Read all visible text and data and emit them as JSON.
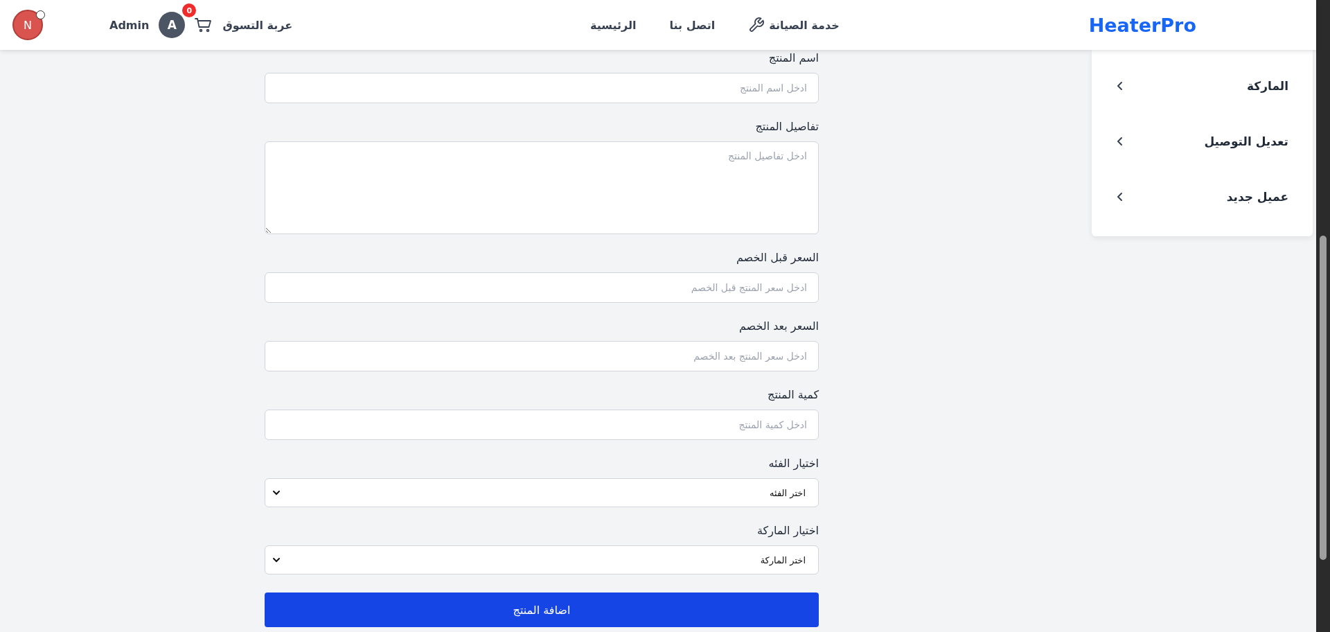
{
  "header": {
    "logo": "HeaterPro",
    "nav": [
      {
        "label": "خدمة الصيانة",
        "kind": "service"
      },
      {
        "label": "اتصل بنا",
        "kind": "link"
      },
      {
        "label": "الرئيسية",
        "kind": "link"
      }
    ],
    "cart": {
      "label": "عربة التسوق",
      "count": "0"
    },
    "user": {
      "initial": "A",
      "name": "Admin"
    },
    "corner_avatar": {
      "letter": "N"
    }
  },
  "sidebar": {
    "items": [
      {
        "label": "الماركة"
      },
      {
        "label": "تعديل التوصيل"
      },
      {
        "label": "عميل جديد"
      }
    ]
  },
  "form": {
    "fields": [
      {
        "kind": "input",
        "label": "اسم المنتج",
        "placeholder": "ادخل اسم المنتج"
      },
      {
        "kind": "textarea",
        "label": "تفاصيل المنتج",
        "placeholder": "ادخل تفاصيل المنتج"
      },
      {
        "kind": "input",
        "label": "السعر قبل الخصم",
        "placeholder": "ادخل سعر المنتج قبل الخصم"
      },
      {
        "kind": "input",
        "label": "السعر بعد الخصم",
        "placeholder": "ادخل سعر المنتج بعد الخصم"
      },
      {
        "kind": "input",
        "label": "كمية المنتج",
        "placeholder": "ادخل كمية المنتج"
      },
      {
        "kind": "select",
        "label": "اختيار الفئه",
        "value": "اختر الفئه"
      },
      {
        "kind": "select",
        "label": "اختيار الماركة",
        "value": "اختر الماركة"
      }
    ],
    "submit": "اضافة المنتج"
  }
}
